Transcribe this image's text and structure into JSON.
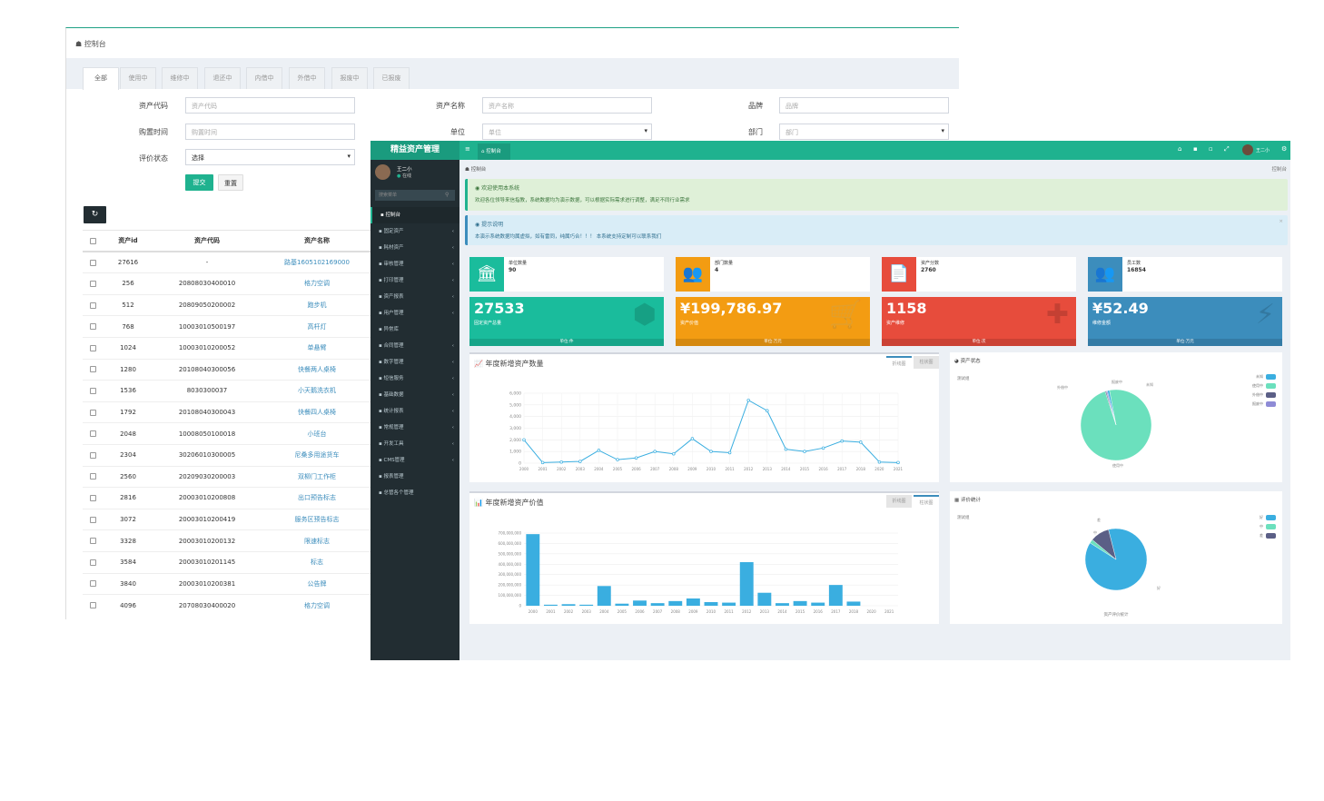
{
  "back": {
    "breadcrumb": "控制台",
    "tabs": [
      "全部",
      "使用中",
      "维修中",
      "退还中",
      "内借中",
      "外借中",
      "报废中",
      "已报废"
    ],
    "filters": {
      "asset_code_label": "资产代码",
      "asset_code_placeholder": "资产代码",
      "asset_name_label": "资产名称",
      "asset_name_placeholder": "资产名称",
      "brand_label": "品牌",
      "brand_placeholder": "品牌",
      "purchase_time_label": "购置时间",
      "purchase_time_placeholder": "购置时间",
      "unit_label": "单位",
      "unit_value": "单位",
      "dept_label": "部门",
      "dept_value": "部门",
      "eval_label": "评价状态",
      "eval_value": "选择"
    },
    "submit_label": "提交",
    "reset_label": "重置",
    "refresh_icon": "refresh-icon",
    "table": {
      "headers": [
        "资产id",
        "资产代码",
        "资产名称"
      ],
      "rows": [
        [
          "27616",
          "-",
          "路基1605102169000"
        ],
        [
          "256",
          "20808030400010",
          "格力空调"
        ],
        [
          "512",
          "20809050200002",
          "跑步机"
        ],
        [
          "768",
          "10003010500197",
          "高杆灯"
        ],
        [
          "1024",
          "10003010200052",
          "单悬臂"
        ],
        [
          "1280",
          "20108040300056",
          "快餐两人桌椅"
        ],
        [
          "1536",
          "8030300037",
          "小天鹅洗衣机"
        ],
        [
          "1792",
          "20108040300043",
          "快餐四人桌椅"
        ],
        [
          "2048",
          "10008050100018",
          "小班台"
        ],
        [
          "2304",
          "30206010300005",
          "尼桑多用途货车"
        ],
        [
          "2560",
          "20209030200003",
          "双柳门工作柜"
        ],
        [
          "2816",
          "20003010200808",
          "出口预告标志"
        ],
        [
          "3072",
          "20003010200419",
          "服务区预告标志"
        ],
        [
          "3328",
          "20003010200132",
          "限速标志"
        ],
        [
          "3584",
          "20003010201145",
          "标志"
        ],
        [
          "3840",
          "20003010200381",
          "公告牌"
        ],
        [
          "4096",
          "20708030400020",
          "格力空调"
        ]
      ]
    }
  },
  "front": {
    "app_title": "精益资产管理",
    "tab_label": "控制台",
    "user_name": "王二小",
    "user_status": "在线",
    "header_user": "王二小",
    "search_placeholder": "搜索菜单",
    "breadcrumb": "控制台",
    "breadcrumb_right": "控制台",
    "menu": [
      "控制台",
      "固定资产",
      "耗材资产",
      "审核管理",
      "打印管理",
      "资产报表",
      "用户管理",
      "异常库",
      "合同管理",
      "数字管理",
      "短信服务",
      "基础数据",
      "统计报表",
      "常规管理",
      "开发工具",
      "CMS管理",
      "报表管理",
      "总管各个管理"
    ],
    "menu_arrows": [
      false,
      true,
      true,
      true,
      true,
      true,
      true,
      false,
      true,
      true,
      true,
      true,
      true,
      true,
      true,
      true,
      false,
      false
    ],
    "alert_success_title": "欢迎使用本系统",
    "alert_success_text": "欢迎各位领导来信指教，系统数据均为演示数据，可以根据实际需求进行调整，满足不同行业需求",
    "alert_info_title": "提示说明",
    "alert_info_text": "本演示系统数据均属虚拟，如有雷同，纯属巧合！！！ 本系统支持定制可以联系我们",
    "cards": [
      {
        "label": "单位数量",
        "value": "90",
        "color": "#1abc9c",
        "icon": "institution-icon"
      },
      {
        "label": "部门数量",
        "value": "4",
        "color": "#f39c12",
        "icon": "users-icon"
      },
      {
        "label": "资产分数",
        "value": "2760",
        "color": "#e74c3c",
        "icon": "files-icon"
      },
      {
        "label": "员工数",
        "value": "16854",
        "color": "#3c8dbc",
        "icon": "group-icon"
      }
    ],
    "stats": [
      {
        "value": "27533",
        "label": "固定资产总量",
        "foot": "单位:件",
        "color": "#1abc9c",
        "icon": "cubes-icon"
      },
      {
        "value": "¥199,786.97",
        "label": "资产价值",
        "foot": "单位:万元",
        "color": "#f39c12",
        "icon": "cart-icon"
      },
      {
        "value": "1158",
        "label": "资产维修",
        "foot": "单位:次",
        "color": "#e74c3c",
        "icon": "ambulance-icon"
      },
      {
        "value": "¥52.49",
        "label": "维修金额",
        "foot": "单位:万元",
        "color": "#3c8dbc",
        "icon": "bolt-icon"
      }
    ],
    "panels": {
      "count_title": "年度新增资产数量",
      "value_title": "年度新增资产价值",
      "status_title": "资产状态",
      "eval_title": "评价统计",
      "tab_line": "折线图",
      "tab_bar": "柱状图",
      "status_sub": "测试组",
      "eval_sub": "测试组",
      "eval_caption": "资产评价统计"
    }
  },
  "chart_data": [
    {
      "type": "line",
      "title": "年度新增资产数量",
      "x": [
        "2000",
        "2001",
        "2002",
        "2003",
        "2004",
        "2005",
        "2006",
        "2007",
        "2008",
        "2009",
        "2010",
        "2011",
        "2012",
        "2013",
        "2014",
        "2015",
        "2016",
        "2017",
        "2018",
        "2020",
        "2021"
      ],
      "values": [
        2000,
        50,
        100,
        150,
        1100,
        300,
        450,
        1000,
        800,
        2100,
        1000,
        900,
        5400,
        4500,
        1200,
        1000,
        1300,
        1900,
        1800,
        100,
        50
      ],
      "ylim": [
        0,
        6000
      ],
      "yticks": [
        "0",
        "1,000",
        "2,000",
        "3,000",
        "4,000",
        "5,000",
        "6,000"
      ],
      "color": "#3aaee0"
    },
    {
      "type": "bar",
      "title": "年度新增资产价值",
      "x": [
        "2000",
        "2001",
        "2002",
        "2003",
        "2004",
        "2005",
        "2006",
        "2007",
        "2008",
        "2009",
        "2010",
        "2011",
        "2012",
        "2013",
        "2014",
        "2015",
        "2016",
        "2017",
        "2018",
        "2020",
        "2021"
      ],
      "values": [
        690000000,
        10000000,
        15000000,
        10000000,
        190000000,
        20000000,
        50000000,
        25000000,
        45000000,
        70000000,
        35000000,
        30000000,
        420000000,
        125000000,
        25000000,
        45000000,
        30000000,
        200000000,
        40000000,
        0,
        0
      ],
      "ylim": [
        0,
        700000000
      ],
      "yticks": [
        "0",
        "100,000,000",
        "200,000,000",
        "300,000,000",
        "400,000,000",
        "500,000,000",
        "600,000,000",
        "700,000,000"
      ],
      "color": "#3aaee0"
    },
    {
      "type": "pie",
      "title": "资产状态",
      "legend": [
        "未知",
        "使用中",
        "外借中",
        "报废中"
      ],
      "callouts": [
        "外借中",
        "报废中",
        "未知",
        "使用中"
      ],
      "values": [
        1,
        98,
        0.5,
        0.5
      ],
      "colors": [
        "#3aaee0",
        "#6be0bd",
        "#5b5f86",
        "#8e8bd6"
      ]
    },
    {
      "type": "pie",
      "title": "评价统计",
      "legend": [
        "好",
        "中",
        "差"
      ],
      "callouts": [
        "好",
        "中",
        "差"
      ],
      "values": [
        88,
        2,
        10
      ],
      "colors": [
        "#3aaee0",
        "#6be0bd",
        "#5b5f86"
      ]
    }
  ]
}
